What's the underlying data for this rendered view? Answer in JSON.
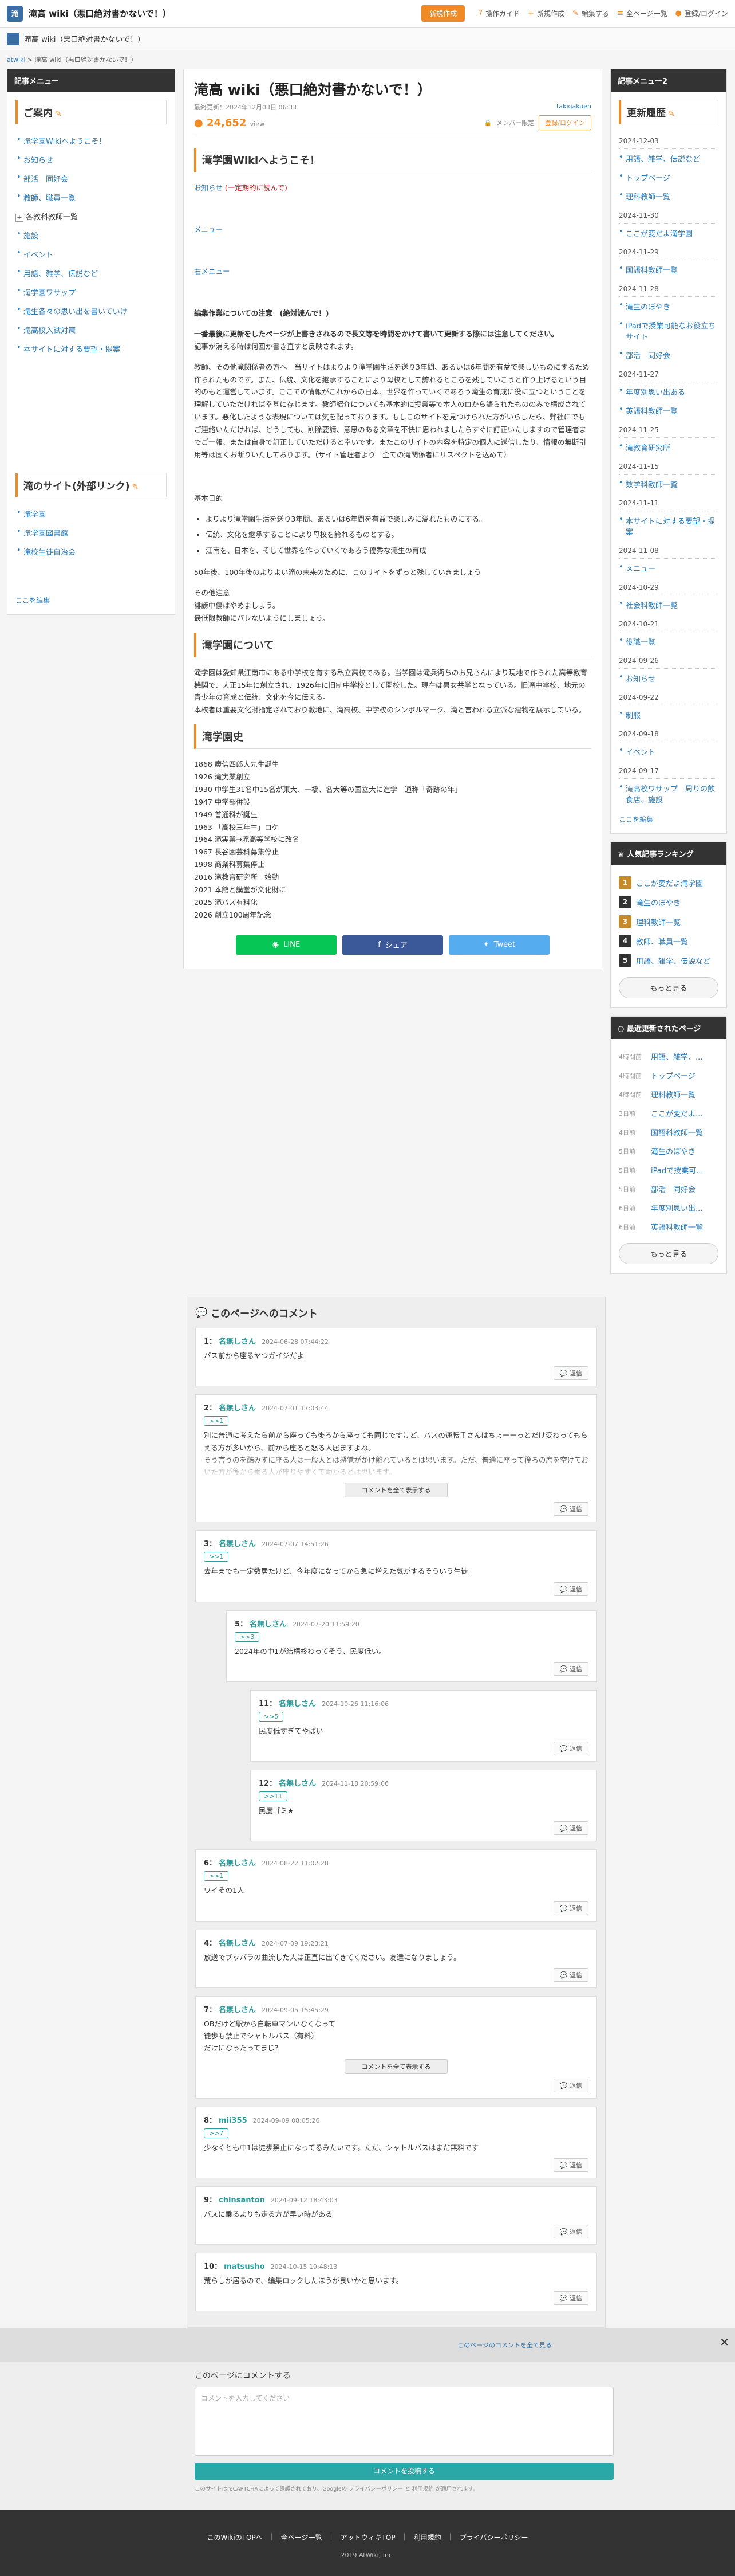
{
  "site": {
    "title": "滝高 wiki（悪口絶対書かないで！）",
    "edit_label": "新規作成",
    "nav": [
      "操作ガイド",
      "新規作成",
      "編集する",
      "全ページ一覧",
      "登録/ログイン"
    ]
  },
  "breadcrumb": [
    "atwiki",
    "滝高 wiki（悪口絶対書かないで！）"
  ],
  "left_sidebar": {
    "head": "記事メニュー",
    "guide_title": "ご案内",
    "guide_items": [
      "滝学園Wikiへようこそ！",
      "お知らせ",
      "部活　同好会",
      "教師、職員一覧"
    ],
    "folder_label": "各教科教師一覧",
    "guide_items2": [
      "施設",
      "イベント",
      "用語、雑学、伝説など",
      "滝学園ワサップ",
      "滝生各々の思い出を書いていけ",
      "滝高校入試対策",
      "本サイトに対する要望・提案"
    ],
    "links_title": "滝のサイト(外部リンク)",
    "links_items": [
      "滝学園",
      "滝学園図書館",
      "滝校生徒自治会"
    ],
    "edit_link": "ここを編集"
  },
  "main": {
    "h1": "滝高 wiki（悪口絶対書かないで！）",
    "updated": "最終更新：2024年12月03日 06:33",
    "author": "takigakuen",
    "views": "24,652",
    "views_unit": "view",
    "member_label": "メンバー限定",
    "login_label": "登録/ログイン",
    "welcome_h2": "滝学園Wikiへようこそ！",
    "notice_link": "お知らせ",
    "notice_note": "(一定期的に読んで)",
    "menu_link": "メニュー",
    "right_menu_link": "右メニュー",
    "editing_title": "編集作業についての注意　(絶対読んで！)",
    "editing_note1": "一番最後に更新をしたページが上書きされるので長文等を時間をかけて書いて更新する際には注意してください。",
    "editing_note2": "記事が消える時は何回か書き直すと反映されます。",
    "editing_note3": "教師、その他滝関係者の方へ　当サイトはよりより滝学園生活を送り3年間、あるいは6年間を有益で楽しいものにするため作られたものです。また、伝統、文化を継承することにより母校として誇れるところを残していこうと作り上げるという目的のもと運営しています。ここでの情報がこれからの日本、世界を作っていくであろう滝生の育成に役に立つということを理解していただければ幸甚に存じます。教師紹介についても基本的に授業等で本人のロから語られたもののみで構成されています。悪化したような表現については気を配っております。もしこのサイトを見つけられた方がいらしたら、弊社にでもご連絡いただければ、どうしても、削除要請、意思のある文章を不快に思われましたらすぐに訂正いたしますので管理者までご一報、または自身で訂正していただけると幸いです。またこのサイトの内容を特定の個人に送信したり、情報の無断引用等は固くお断りいたしております。（サイト管理者より　全ての滝関係者にリスペクトを込めて）",
    "policy_title": "基本目的",
    "policy_items": [
      "よりより滝学園生活を送り3年間、あるいは6年間を有益で楽しみに溢れたものにする。",
      "伝統、文化を継承することにより母校を誇れるものとする。",
      "江南を、日本を、そして世界を作っていくであろう優秀な滝生の育成"
    ],
    "aim_text": "50年後、100年後のよりよい滝の未来のために、このサイトをずっと残していきましょう",
    "misc_lines": [
      "その他注意",
      "誹謗中傷はやめましょう。",
      "最低限教師にバレないようにしましょう。"
    ],
    "about_h2": "滝学園について",
    "about_text": "滝学園は愛知県江南市にある中学校を有する私立高校である。当学園は滝兵衛ちのお兄さんにより現地で作られた高等教育機関で、大正15年に創立され、1926年に旧制中学校として開校した。現在は男女共学となっている。旧滝中学校、地元の青少年の育成と伝統、文化を今に伝える。",
    "about_text2": "本校者は重要文化財指定されており敷地に、滝高校、中学校のシンボルマーク、滝と言われる立派な建物を展示している。",
    "history_h2": "滝学園史",
    "history": [
      "1868 廣信四郎大先生誕生",
      "1926 滝実業創立",
      "1930 中学生31名中15名が東大、一橋、名大等の国立大に進学　通称「奇跡の年」",
      "1947 中学部併設",
      "1949 普通科が誕生",
      "1963 「高校三年生」ロケ",
      "1964 滝実業→滝高等学校に改名",
      "1967 長谷園芸科募集停止",
      "1998 商業科募集停止",
      "2016 滝教育研究所　始動",
      "2021 本館と講堂が文化財に",
      "2025 滝バス有料化",
      "2026 創立100周年記念"
    ],
    "share": [
      "LINE",
      "シェア",
      "Tweet"
    ]
  },
  "right_sidebar": {
    "head": "記事メニュー2",
    "update_title": "更新履歴",
    "updates": [
      {
        "date": "2024-12-03",
        "pages": [
          "用語、雑学、伝説など",
          "トップページ",
          "理科教師一覧"
        ]
      },
      {
        "date": "2024-11-30",
        "pages": [
          "ここが変だよ滝学園"
        ]
      },
      {
        "date": "2024-11-29",
        "pages": [
          "国語科教師一覧"
        ]
      },
      {
        "date": "2024-11-28",
        "pages": [
          "滝生のぼやき",
          "iPadで授業可能なお役立ちサイト",
          "部活　同好会"
        ]
      },
      {
        "date": "2024-11-27",
        "pages": [
          "年度別思い出ある",
          "英語科教師一覧"
        ]
      },
      {
        "date": "2024-11-25",
        "pages": [
          "滝教育研究所"
        ]
      },
      {
        "date": "2024-11-15",
        "pages": [
          "数学科教師一覧"
        ]
      },
      {
        "date": "2024-11-11",
        "pages": [
          "本サイトに対する要望・提案"
        ]
      },
      {
        "date": "2024-11-08",
        "pages": [
          "メニュー"
        ]
      },
      {
        "date": "2024-10-29",
        "pages": [
          "社会科教師一覧"
        ]
      },
      {
        "date": "2024-10-21",
        "pages": [
          "役職一覧"
        ]
      },
      {
        "date": "2024-09-26",
        "pages": [
          "お知らせ"
        ]
      },
      {
        "date": "2024-09-22",
        "pages": [
          "制服"
        ]
      },
      {
        "date": "2024-09-18",
        "pages": [
          "イベント"
        ]
      },
      {
        "date": "2024-09-17",
        "pages": [
          "滝高校ワサップ　周りの飲食店、施設"
        ]
      }
    ],
    "edit_link": "ここを編集",
    "ranking_head": "人気記事ランキング",
    "ranking": [
      "ここが変だよ滝学園",
      "滝生のぼやき",
      "理科教師一覧",
      "教師、職員一覧",
      "用語、雑学、伝説など"
    ],
    "rank_colors": [
      "#c58a2a",
      "#333333",
      "#c58a2a",
      "#333333",
      "#333333"
    ],
    "more_label": "もっと見る",
    "recent_head": "最近更新されたページ",
    "recent": [
      {
        "ago": "4時間前",
        "title": "用語、雑学、..."
      },
      {
        "ago": "4時間前",
        "title": "トップページ"
      },
      {
        "ago": "4時間前",
        "title": "理科教師一覧"
      },
      {
        "ago": "3日前",
        "title": "ここが変だよ..."
      },
      {
        "ago": "4日前",
        "title": "国語科教師一覧"
      },
      {
        "ago": "5日前",
        "title": "滝生のぼやき"
      },
      {
        "ago": "5日前",
        "title": "iPadで授業可..."
      },
      {
        "ago": "5日前",
        "title": "部活　同好会"
      },
      {
        "ago": "6日前",
        "title": "年度別思い出..."
      },
      {
        "ago": "6日前",
        "title": "英語科教師一覧"
      }
    ]
  },
  "comments": {
    "head": "このページへのコメント",
    "reply_label": "返信",
    "showall_label": "コメントを全て表示する",
    "items": [
      {
        "num": "1",
        "name": "名無しさん",
        "date": "2024-06-28 07:44:22",
        "ref": "",
        "text": "バス前から座るヤつガイジだよ",
        "indent": 0,
        "fade": false,
        "showall": false
      },
      {
        "num": "2",
        "name": "名無しさん",
        "date": "2024-07-01 17:03:44",
        "ref": ">>1",
        "text": "別に普通に考えたら前から座っても後ろから座っても同じですけど、バスの運転手さんはちょーーっとだけ変わってもらえる方が多いから、前から座ると怒る人居ますよね。\nそう言うのを酷みずに座る人は一般人とは感覚がかけ離れているとは思います。ただ、普通に座って後ろの席を空けておいた方が後から乗る人が座りやすくて助かるとは思います。",
        "indent": 0,
        "fade": true,
        "showall": true
      },
      {
        "num": "3",
        "name": "名無しさん",
        "date": "2024-07-07 14:51:26",
        "ref": ">>1",
        "text": "去年までも一定数居たけど、今年度になってから急に増えた気がするそういう生徒",
        "indent": 0,
        "fade": false,
        "showall": false
      },
      {
        "num": "5",
        "name": "名無しさん",
        "date": "2024-07-20 11:59:20",
        "ref": ">>3",
        "text": "2024年の中1が結構終わってそう、民度低い。",
        "indent": 1,
        "fade": false,
        "showall": false
      },
      {
        "num": "11",
        "name": "名無しさん",
        "date": "2024-10-26 11:16:06",
        "ref": ">>5",
        "text": "民度低すぎてやばい",
        "indent": 2,
        "fade": false,
        "showall": false
      },
      {
        "num": "12",
        "name": "名無しさん",
        "date": "2024-11-18 20:59:06",
        "ref": ">>11",
        "text": "民度ゴミ★",
        "indent": 2,
        "fade": false,
        "showall": false
      },
      {
        "num": "6",
        "name": "名無しさん",
        "date": "2024-08-22 11:02:28",
        "ref": ">>1",
        "text": "ワイその1人",
        "indent": 0,
        "fade": false,
        "showall": false
      },
      {
        "num": "4",
        "name": "名無しさん",
        "date": "2024-07-09 19:23:21",
        "ref": "",
        "text": "放送でブッパラの曲流した人は正直に出てきてください。友達になりましょう。",
        "indent": 0,
        "fade": false,
        "showall": false
      },
      {
        "num": "7",
        "name": "名無しさん",
        "date": "2024-09-05 15:45:29",
        "ref": "",
        "text": "OBだけど駅から自転車マンいなくなって\n徒歩も禁止でシャトルバス（有料）\nだけになったってまじ？",
        "indent": 0,
        "fade": false,
        "showall": true
      },
      {
        "num": "8",
        "name": "mii355",
        "date": "2024-09-09 08:05:26",
        "ref": ">>7",
        "text": "少なくとも中1は徒歩禁止になってるみたいです。ただ、シャトルバスはまだ無料です",
        "indent": 0,
        "fade": false,
        "showall": false
      },
      {
        "num": "9",
        "name": "chinsanton",
        "date": "2024-09-12 18:43:03",
        "ref": "",
        "text": "バスに乗るよりも走る方が早い時がある",
        "indent": 0,
        "fade": false,
        "showall": false
      },
      {
        "num": "10",
        "name": "matsusho",
        "date": "2024-10-15 19:48:13",
        "ref": "",
        "text": "荒らしが居るので、編集ロックしたほうが良いかと思います。",
        "indent": 0,
        "fade": false,
        "showall": false
      }
    ]
  },
  "comment_form": {
    "show_all_link": "このページのコメントを全て見る",
    "title": "このページにコメントする",
    "placeholder": "コメントを入力してください",
    "submit_label": "コメントを投稿する",
    "note": "このサイトはreCAPTCHAによって保護されており、Googleの プライバシーポリシー と 利用規約 が適用されます。"
  },
  "footer": {
    "links": [
      "このWikiのTOPへ",
      "全ページ一覧",
      "アットウィキTOP",
      "利用規約",
      "プライバシーポリシー"
    ],
    "copyright": "2019 AtWiki, Inc."
  }
}
